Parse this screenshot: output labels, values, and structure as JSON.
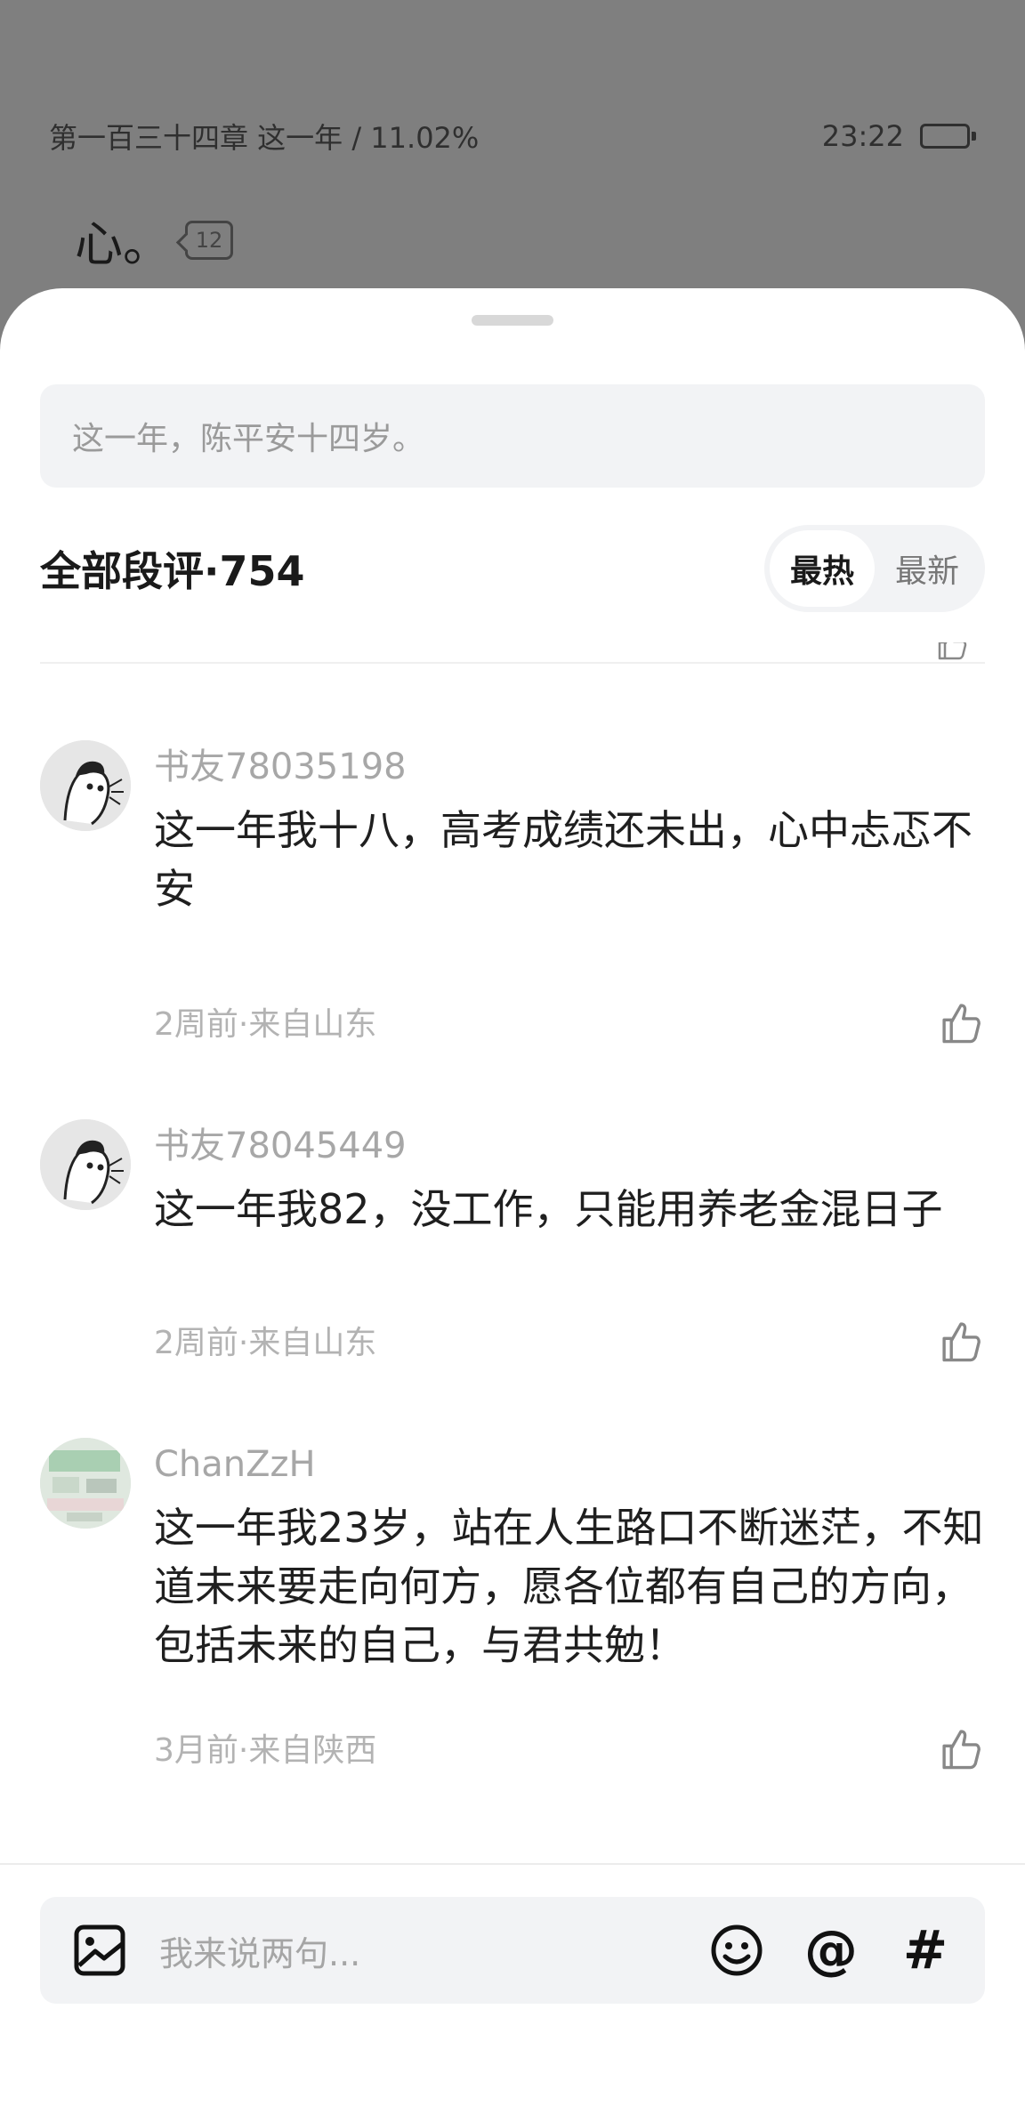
{
  "reader": {
    "chapter_progress": "第一百三十四章 这一年 / 11.02%",
    "time": "23:22",
    "battery_level": 0.8,
    "visible_text": "心。",
    "paragraph_comment_count": "12"
  },
  "sheet": {
    "quoted_sentence": "这一年，陈平安十四岁。",
    "section_title": "全部段评·754",
    "sort": {
      "hot": "最热",
      "new": "最新",
      "active": "最热"
    }
  },
  "comments": [
    {
      "user": "书友78035198",
      "text": "这一年我十八，高考成绩还未出，心中忐忑不安",
      "meta": "2周前·来自山东"
    },
    {
      "user": "书友78045449",
      "text": "这一年我82，没工作，只能用养老金混日子",
      "meta": "2周前·来自山东"
    },
    {
      "user": "ChanZzH",
      "text": "这一年我23岁，站在人生路口不断迷茫，不知道未来要走向何方，愿各位都有自己的方向，包括未来的自己，与君共勉！",
      "meta": "3月前·来自陕西"
    }
  ],
  "composer": {
    "placeholder": "我来说两句...",
    "at_symbol": "@",
    "hash_symbol": "#",
    "icons": [
      "image-icon",
      "emoji-icon",
      "at-icon",
      "hashtag-icon"
    ]
  },
  "colors": {
    "sheet_bg": "#ffffff",
    "dim_bg": "#7f7f7f",
    "input_bg": "#f2f3f5",
    "meta_gray": "#b3b3b3"
  }
}
